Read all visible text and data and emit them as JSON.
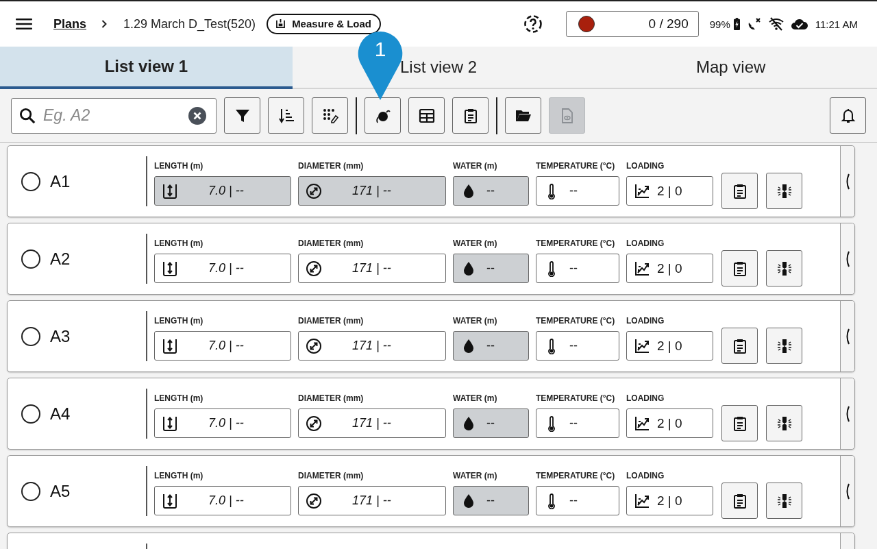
{
  "header": {
    "breadcrumb_link": "Plans",
    "title": "1.29 March D_Test(520)",
    "mode_chip": "Measure & Load",
    "counter": "0 / 290",
    "battery": "99%",
    "time": "11:21 AM"
  },
  "tabs": [
    {
      "label": "List view 1",
      "selected": true
    },
    {
      "label": "List view 2",
      "selected": false
    },
    {
      "label": "Map view",
      "selected": false
    }
  ],
  "search": {
    "placeholder": "Eg. A2"
  },
  "toolbar_groups": [
    [
      {
        "kind": "filter",
        "disabled": false
      },
      {
        "kind": "sort",
        "disabled": false
      },
      {
        "kind": "dots-edit",
        "disabled": false
      }
    ],
    [
      {
        "kind": "ball",
        "disabled": false
      },
      {
        "kind": "table",
        "disabled": false
      },
      {
        "kind": "clipboard",
        "disabled": false
      }
    ],
    [
      {
        "kind": "folder",
        "disabled": false
      },
      {
        "kind": "doc-view",
        "disabled": true
      }
    ]
  ],
  "callout": {
    "label": "1"
  },
  "rows": [
    {
      "name": "A1",
      "selected": false,
      "fields": [
        {
          "kind": "length",
          "label": "LENGTH (m)",
          "value": "7.0 | --",
          "shaded": true
        },
        {
          "kind": "diameter",
          "label": "DIAMETER (mm)",
          "value": "171 | --",
          "shaded": true
        },
        {
          "kind": "water",
          "label": "WATER (m)",
          "value": "--",
          "shaded": true
        },
        {
          "kind": "temperature",
          "label": "TEMPERATURE (°C)",
          "value": "--",
          "shaded": false
        },
        {
          "kind": "loading",
          "label": "LOADING",
          "value": "2 | 0",
          "shaded": false
        }
      ]
    },
    {
      "name": "A2",
      "selected": false,
      "fields": [
        {
          "kind": "length",
          "label": "LENGTH (m)",
          "value": "7.0 | --",
          "shaded": false
        },
        {
          "kind": "diameter",
          "label": "DIAMETER (mm)",
          "value": "171 | --",
          "shaded": false
        },
        {
          "kind": "water",
          "label": "WATER (m)",
          "value": "--",
          "shaded": true
        },
        {
          "kind": "temperature",
          "label": "TEMPERATURE (°C)",
          "value": "--",
          "shaded": false
        },
        {
          "kind": "loading",
          "label": "LOADING",
          "value": "2 | 0",
          "shaded": false
        }
      ]
    },
    {
      "name": "A3",
      "selected": false,
      "fields": [
        {
          "kind": "length",
          "label": "LENGTH (m)",
          "value": "7.0 | --",
          "shaded": false
        },
        {
          "kind": "diameter",
          "label": "DIAMETER (mm)",
          "value": "171 | --",
          "shaded": false
        },
        {
          "kind": "water",
          "label": "WATER (m)",
          "value": "--",
          "shaded": true
        },
        {
          "kind": "temperature",
          "label": "TEMPERATURE (°C)",
          "value": "--",
          "shaded": false
        },
        {
          "kind": "loading",
          "label": "LOADING",
          "value": "2 | 0",
          "shaded": false
        }
      ]
    },
    {
      "name": "A4",
      "selected": false,
      "fields": [
        {
          "kind": "length",
          "label": "LENGTH (m)",
          "value": "7.0 | --",
          "shaded": false
        },
        {
          "kind": "diameter",
          "label": "DIAMETER (mm)",
          "value": "171 | --",
          "shaded": false
        },
        {
          "kind": "water",
          "label": "WATER (m)",
          "value": "--",
          "shaded": true
        },
        {
          "kind": "temperature",
          "label": "TEMPERATURE (°C)",
          "value": "--",
          "shaded": false
        },
        {
          "kind": "loading",
          "label": "LOADING",
          "value": "2 | 0",
          "shaded": false
        }
      ]
    },
    {
      "name": "A5",
      "selected": false,
      "fields": [
        {
          "kind": "length",
          "label": "LENGTH (m)",
          "value": "7.0 | --",
          "shaded": false
        },
        {
          "kind": "diameter",
          "label": "DIAMETER (mm)",
          "value": "171 | --",
          "shaded": false
        },
        {
          "kind": "water",
          "label": "WATER (m)",
          "value": "--",
          "shaded": true
        },
        {
          "kind": "temperature",
          "label": "TEMPERATURE (°C)",
          "value": "--",
          "shaded": false
        },
        {
          "kind": "loading",
          "label": "LOADING",
          "value": "2 | 0",
          "shaded": false
        }
      ]
    }
  ]
}
